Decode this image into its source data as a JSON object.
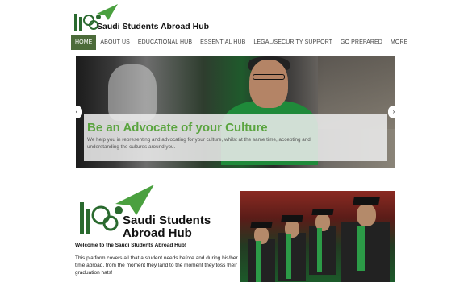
{
  "brand": {
    "name": "Saudi Students Abroad Hub",
    "accent": "#5aa43f",
    "nav_active": "#4c6b3a"
  },
  "nav": {
    "items": [
      "HOME",
      "ABOUT US",
      "EDUCATIONAL HUB",
      "ESSENTIAL HUB",
      "LEGAL/SECURITY SUPPORT",
      "GO PREPARED",
      "MORE"
    ]
  },
  "hero": {
    "title": "Be an Advocate of your Culture",
    "text": "We help you in representing and advocating for your culture, whilst at the same time, accepting and understanding the cultures around you.",
    "prev_icon": "chevron-left-icon",
    "next_icon": "chevron-right-icon"
  },
  "about": {
    "logo_line1": "Saudi Students",
    "logo_line2": "Abroad Hub",
    "welcome": "Welcome to the Saudi  Students Abroad Hub!",
    "body": "This platform covers all that a student needs before and during his/her time abroad, from the moment they land to the moment they toss their graduation hats!"
  }
}
